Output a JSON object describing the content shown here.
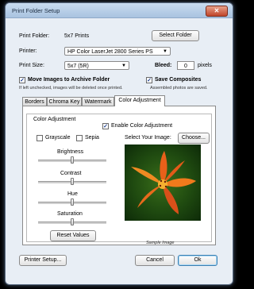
{
  "window": {
    "title": "Print Folder Setup",
    "close_glyph": "✕"
  },
  "print_folder": {
    "label": "Print Folder:",
    "value": "5x7 Prints",
    "select_button": "Select Folder"
  },
  "printer": {
    "label": "Printer:",
    "selected": "HP Color LaserJet 2800 Series PS"
  },
  "print_size": {
    "label": "Print Size:",
    "selected": "5x7 (5R)"
  },
  "bleed": {
    "label": "Bleed:",
    "value": "0",
    "unit": "pixels"
  },
  "move_images": {
    "label": "Move Images to Archive Folder",
    "checked": true,
    "note": "If left unchecked, images will be deleted once printed."
  },
  "save_composites": {
    "label": "Save Composites",
    "checked": true,
    "note": "Assembled photos are saved."
  },
  "tabs": [
    {
      "label": "Borders"
    },
    {
      "label": "Chroma Key"
    },
    {
      "label": "Watermark"
    },
    {
      "label": "Color Adjustment"
    }
  ],
  "color_adjustment": {
    "group_title": "Color Adjustment",
    "enable_label": "Enable Color Adjustment",
    "enable_checked": true,
    "grayscale_label": "Grayscale",
    "grayscale_checked": false,
    "sepia_label": "Sepia",
    "sepia_checked": false,
    "select_image_label": "Select Your Image:",
    "choose_button": "Choose...",
    "sliders": [
      {
        "label": "Brightness",
        "value": 0.5
      },
      {
        "label": "Contrast",
        "value": 0.5
      },
      {
        "label": "Hue",
        "value": 0.5
      },
      {
        "label": "Saturation",
        "value": 0.5
      }
    ],
    "reset_button": "Reset Values",
    "sample_caption": "Sample Image"
  },
  "footer": {
    "printer_setup_button": "Printer Setup...",
    "cancel_button": "Cancel",
    "ok_button": "Ok"
  },
  "icons": {
    "dropdown_arrow": "▼",
    "checkmark": "✓"
  },
  "colors": {
    "titlebar": "#a9c3e0",
    "window_bg": "#e8eef5",
    "close_button": "#c0452a"
  }
}
